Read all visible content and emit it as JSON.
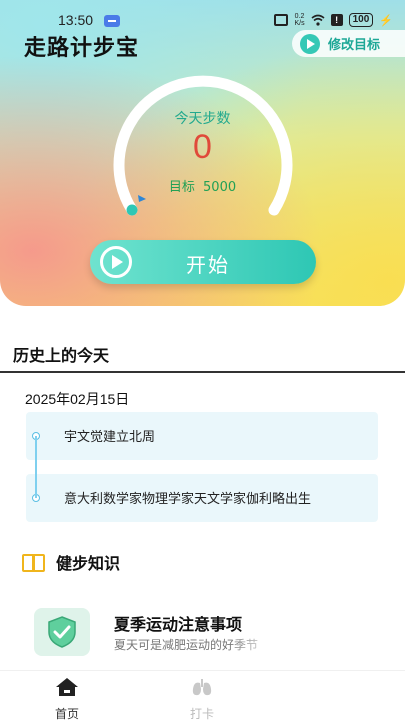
{
  "status_bar": {
    "time": "13:50",
    "net_speed_top": "0.2",
    "net_speed_bottom": "K/s",
    "battery": "100"
  },
  "header": {
    "app_title": "走路计步宝",
    "goal_button_label": "修改目标"
  },
  "steps": {
    "today_label": "今天步数",
    "count": "0",
    "target_label": "目标",
    "target_value": "5000",
    "progress_fraction": 0
  },
  "start_button_label": "开始",
  "history": {
    "title": "历史上的今天",
    "date": "2025年02月15日",
    "events": [
      "宇文觉建立北周",
      "意大利数学家物理学家天文学家伽利略出生"
    ]
  },
  "knowledge": {
    "title": "健步知识",
    "article_title": "夏季运动注意事项",
    "article_subtitle": "夏天可是减肥运动的好季节"
  },
  "tabbar": {
    "home_label": "首页",
    "punch_label": "打卡"
  },
  "colors": {
    "accent_teal": "#2ec7b4",
    "step_count_red": "#e04a3a",
    "today_label_green": "#22a98e",
    "icon_gold": "#f0b51c"
  }
}
